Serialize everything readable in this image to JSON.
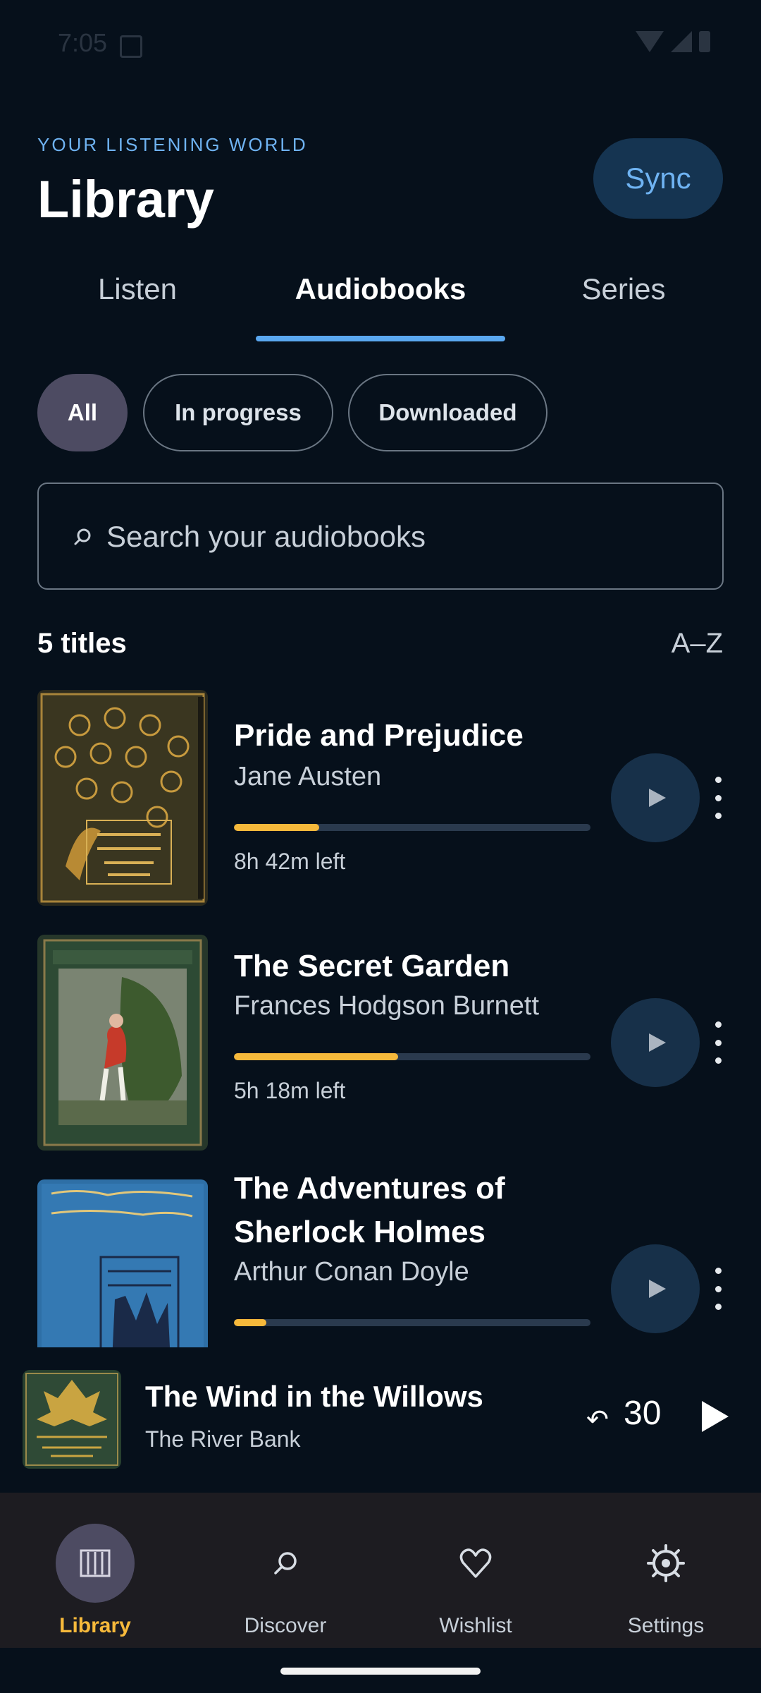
{
  "status_bar": {
    "time": "7:05"
  },
  "header": {
    "eyebrow": "YOUR LISTENING WORLD",
    "title": "Library",
    "sync_label": "Sync"
  },
  "tabs": [
    {
      "label": "Listen",
      "active": false
    },
    {
      "label": "Audiobooks",
      "active": true
    },
    {
      "label": "Series",
      "active": false
    }
  ],
  "filters": [
    {
      "label": "All",
      "selected": true
    },
    {
      "label": "In progress",
      "selected": false
    },
    {
      "label": "Downloaded",
      "selected": false
    }
  ],
  "search": {
    "placeholder": "Search your audiobooks",
    "value": ""
  },
  "list_header": {
    "count": "5 titles",
    "sort": "A–Z"
  },
  "books": [
    {
      "title": "Pride and Prejudice",
      "author": "Jane Austen",
      "progress": 0.24,
      "time_left": "8h 42m left"
    },
    {
      "title": "The Secret Garden",
      "author": "Frances Hodgson Burnett",
      "progress": 0.46,
      "time_left": "5h 18m left"
    },
    {
      "title": "The Adventures of Sherlock Holmes",
      "author": "Arthur Conan Doyle",
      "progress": 0.09,
      "time_left": ""
    }
  ],
  "now_playing": {
    "title": "The Wind in the Willows",
    "chapter": "The River Bank",
    "rewind_label": "30"
  },
  "bottom_nav": [
    {
      "label": "Library",
      "icon": "library-icon",
      "active": true
    },
    {
      "label": "Discover",
      "icon": "search-icon",
      "active": false
    },
    {
      "label": "Wishlist",
      "icon": "heart-icon",
      "active": false
    },
    {
      "label": "Settings",
      "icon": "gear-icon",
      "active": false
    }
  ],
  "colors": {
    "background": "#06101b",
    "accent_blue": "#5aa8f0",
    "accent_orange": "#f6b93b",
    "chip_selected": "#4d4b62",
    "nav_background": "#1d1c21"
  }
}
